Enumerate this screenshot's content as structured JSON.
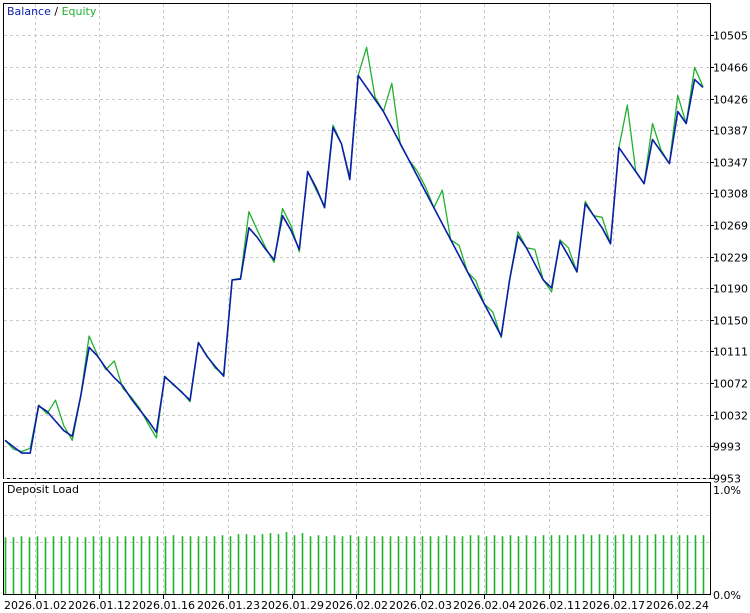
{
  "legend": {
    "balance": "Balance",
    "separator": " / ",
    "equity": "Equity"
  },
  "panel_title": "Deposit Load",
  "colors": {
    "balance": "#0a1fa8",
    "equity": "#21b12d",
    "load": "#21b12d",
    "grid": "#c9c9c9",
    "axis": "#000000"
  },
  "chart_data": [
    {
      "type": "line",
      "legend_entries": [
        "Balance",
        "Equity"
      ],
      "ylim": [
        9953,
        10544
      ],
      "y_ticks": [
        "10505",
        "10466",
        "10426",
        "10387",
        "10347",
        "10308",
        "10269",
        "10229",
        "10190",
        "10150",
        "10111",
        "10072",
        "10032",
        "9993",
        "9953"
      ],
      "y_tick_values": [
        10505,
        10466,
        10426,
        10387,
        10347,
        10308,
        10269,
        10229,
        10190,
        10150,
        10111,
        10072,
        10032,
        9993,
        9953
      ],
      "x_ticks": [
        "2026.01.02",
        "2026.01.12",
        "2026.01.16",
        "2026.01.23",
        "2026.01.29",
        "2026.02.02",
        "2026.02.03",
        "2026.02.04",
        "2026.02.11",
        "2026.02.17",
        "2026.02.24"
      ],
      "grid": true,
      "series": [
        {
          "name": "Balance",
          "values": [
            10000,
            9992,
            9984,
            9984,
            10043,
            10036,
            10024,
            10012,
            10005,
            10055,
            10116,
            10105,
            10090,
            10078,
            10068,
            10052,
            10038,
            10025,
            10010,
            10079,
            10070,
            10060,
            10050,
            10122,
            10105,
            10092,
            10080,
            10200,
            10201,
            10265,
            10253,
            10238,
            10225,
            10280,
            10262,
            10238,
            10335,
            10315,
            10290,
            10390,
            10370,
            10325,
            10455,
            10440,
            10425,
            10410,
            10390,
            10370,
            10350,
            10330,
            10310,
            10290,
            10270,
            10250,
            10230,
            10210,
            10190,
            10170,
            10150,
            10130,
            10200,
            10255,
            10240,
            10220,
            10200,
            10190,
            10248,
            10230,
            10210,
            10295,
            10280,
            10265,
            10245,
            10365,
            10350,
            10335,
            10320,
            10375,
            10360,
            10345,
            10410,
            10395,
            10450,
            10440
          ]
        },
        {
          "name": "Equity",
          "values": [
            10000,
            9989,
            9986,
            9990,
            10044,
            10033,
            10050,
            10018,
            10000,
            10055,
            10130,
            10106,
            10088,
            10099,
            10065,
            10054,
            10040,
            10021,
            10003,
            10080,
            10069,
            10061,
            10048,
            10122,
            10106,
            10090,
            10082,
            10200,
            10202,
            10285,
            10262,
            10240,
            10222,
            10289,
            10268,
            10235,
            10335,
            10312,
            10292,
            10393,
            10370,
            10328,
            10455,
            10490,
            10428,
            10410,
            10445,
            10369,
            10350,
            10336,
            10316,
            10290,
            10312,
            10250,
            10243,
            10210,
            10199,
            10170,
            10160,
            10128,
            10200,
            10260,
            10240,
            10238,
            10200,
            10185,
            10250,
            10240,
            10210,
            10298,
            10280,
            10278,
            10245,
            10365,
            10418,
            10336,
            10320,
            10395,
            10362,
            10345,
            10430,
            10395,
            10465,
            10441
          ]
        }
      ]
    },
    {
      "type": "bar",
      "title": "Deposit Load",
      "y_ticks": [
        "1.0%",
        "0.0%"
      ],
      "ylim": [
        0,
        1.0
      ],
      "series": [
        {
          "values": [
            0.54,
            0.54,
            0.55,
            0.54,
            0.55,
            0.54,
            0.55,
            0.55,
            0.55,
            0.54,
            0.54,
            0.55,
            0.55,
            0.54,
            0.55,
            0.55,
            0.55,
            0.55,
            0.55,
            0.55,
            0.55,
            0.56,
            0.55,
            0.55,
            0.55,
            0.55,
            0.55,
            0.56,
            0.55,
            0.57,
            0.57,
            0.56,
            0.57,
            0.58,
            0.57,
            0.59,
            0.56,
            0.58,
            0.55,
            0.56,
            0.55,
            0.56,
            0.55,
            0.56,
            0.55,
            0.55,
            0.55,
            0.55,
            0.55,
            0.55,
            0.55,
            0.55,
            0.55,
            0.55,
            0.55,
            0.56,
            0.55,
            0.55,
            0.56,
            0.56,
            0.55,
            0.56,
            0.55,
            0.56,
            0.55,
            0.56,
            0.55,
            0.56,
            0.56,
            0.56,
            0.56,
            0.56,
            0.57,
            0.56,
            0.57,
            0.56,
            0.56,
            0.57,
            0.56,
            0.56,
            0.56,
            0.57,
            0.56,
            0.56,
            0.56,
            0.56,
            0.56,
            0.56
          ]
        }
      ]
    }
  ]
}
